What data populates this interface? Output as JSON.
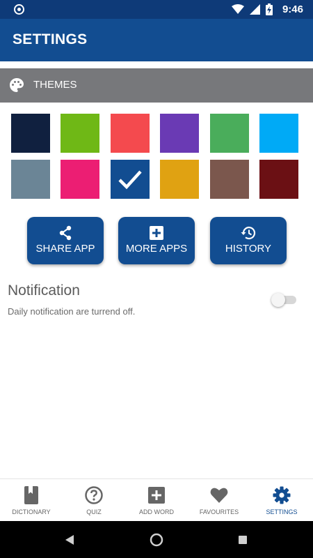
{
  "status_bar": {
    "time": "9:46",
    "icons": [
      "app-logo-icon",
      "wifi-icon",
      "cell-signal-icon",
      "battery-charging-icon"
    ]
  },
  "app_bar": {
    "title": "SETTINGS"
  },
  "themes": {
    "label": "THEMES",
    "icon": "palette-icon",
    "swatches": [
      {
        "color": "#10203f",
        "selected": false
      },
      {
        "color": "#6fb816",
        "selected": false
      },
      {
        "color": "#f44a4e",
        "selected": false
      },
      {
        "color": "#6a3ab4",
        "selected": false
      },
      {
        "color": "#4aad5b",
        "selected": false
      },
      {
        "color": "#00aaf6",
        "selected": false
      },
      {
        "color": "#6b8596",
        "selected": false
      },
      {
        "color": "#ec1e73",
        "selected": false
      },
      {
        "color": "#124d91",
        "selected": true
      },
      {
        "color": "#e0a212",
        "selected": false
      },
      {
        "color": "#7b574d",
        "selected": false
      },
      {
        "color": "#6b1014",
        "selected": false
      }
    ]
  },
  "actions": {
    "share": {
      "label": "SHARE APP",
      "icon": "share-icon"
    },
    "more": {
      "label": "MORE APPS",
      "icon": "plus-box-icon"
    },
    "history": {
      "label": "HISTORY",
      "icon": "history-icon"
    }
  },
  "notification": {
    "title": "Notification",
    "subtitle": "Daily notification are turrend off.",
    "enabled": false
  },
  "bottom_nav": {
    "items": [
      {
        "label": "DICTIONARY",
        "icon": "book-icon",
        "active": false
      },
      {
        "label": "QUIZ",
        "icon": "question-circle-icon",
        "active": false
      },
      {
        "label": "ADD WORD",
        "icon": "plus-box-icon",
        "active": false
      },
      {
        "label": "FAVOURITES",
        "icon": "heart-icon",
        "active": false
      },
      {
        "label": "SETTINGS",
        "icon": "gear-icon",
        "active": true
      }
    ]
  },
  "colors": {
    "primary": "#124d91",
    "status_bar": "#0e3a78",
    "header_gray": "#77787b",
    "nav_inactive": "#666666"
  }
}
